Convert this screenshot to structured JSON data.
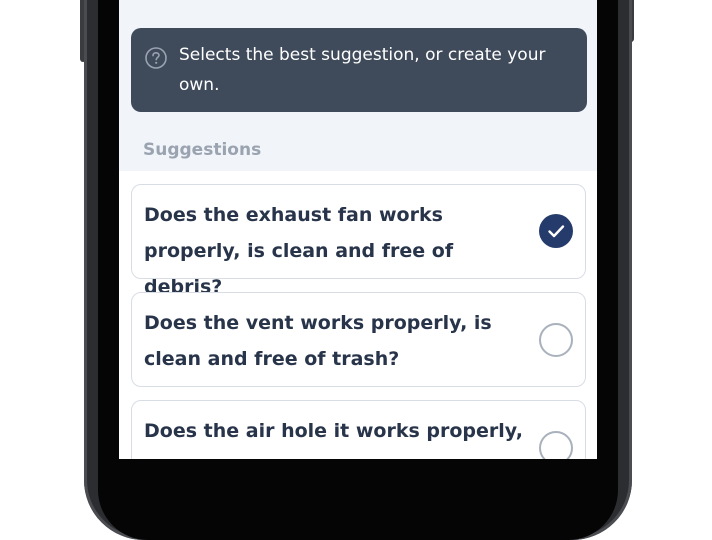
{
  "hint": {
    "icon": "question-circle-icon",
    "text": "Selects the best suggestion, or create your own."
  },
  "suggestions_title": "Suggestions",
  "options": [
    {
      "label": "Does the exhaust fan works properly, is clean and free of debris?",
      "selected": true
    },
    {
      "label": "Does the vent works properly, is clean and free of trash?",
      "selected": false
    },
    {
      "label": "Does the air hole it works properly, is clean and free of trash?",
      "selected": false
    }
  ],
  "colors": {
    "hint_background": "#3f4a5a",
    "selected_radio": "#243b6b",
    "option_text": "#28344a",
    "section_title": "#9aa3b0"
  }
}
